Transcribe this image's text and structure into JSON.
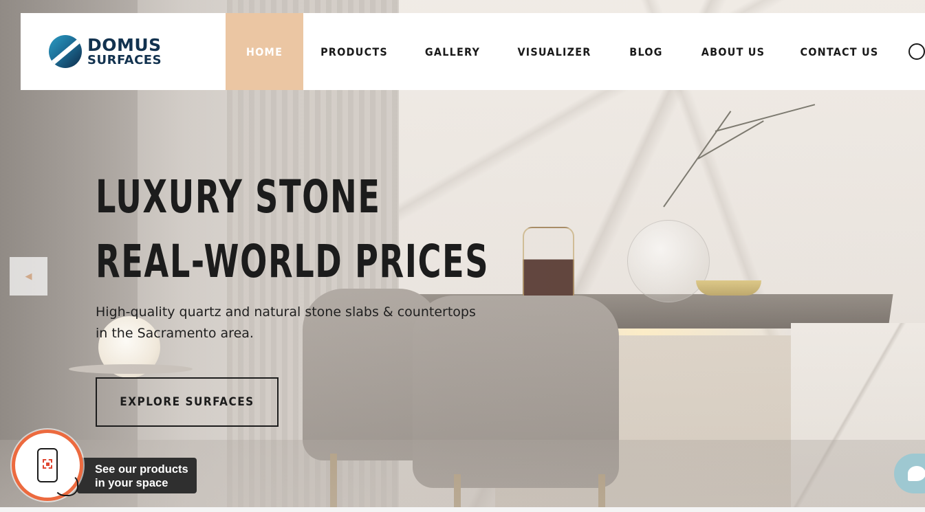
{
  "brand": {
    "name_line1": "DOMUS",
    "name_line2": "SURFACES"
  },
  "nav": {
    "items": [
      {
        "label": "HOME",
        "active": true
      },
      {
        "label": "PRODUCTS",
        "active": false
      },
      {
        "label": "GALLERY",
        "active": false
      },
      {
        "label": "VISUALIZER",
        "active": false
      },
      {
        "label": "BLOG",
        "active": false
      },
      {
        "label": "ABOUT US",
        "active": false
      },
      {
        "label": "CONTACT US",
        "active": false
      }
    ],
    "search_icon": "search-icon"
  },
  "hero": {
    "headline_line1": "LUXURY STONE",
    "headline_line2": "REAL-WORLD PRICES",
    "subtext_line1": "High-quality quartz and natural stone slabs & countertops",
    "subtext_line2": "in the Sacramento area.",
    "cta_label": "EXPLORE SURFACES",
    "prev_icon": "triangle-left-icon"
  },
  "ar_widget": {
    "label_line1": "See our products",
    "label_line2": "in your space",
    "icon": "phone-ar-icon"
  },
  "chat": {
    "icon": "chat-bubble-icon"
  },
  "colors": {
    "accent": "#ebc6a3",
    "brand_navy": "#12324f",
    "brand_blue": "#2a9bc3",
    "ar_ring": "#ec6a3f",
    "chat_bg": "#9ec8d1"
  }
}
